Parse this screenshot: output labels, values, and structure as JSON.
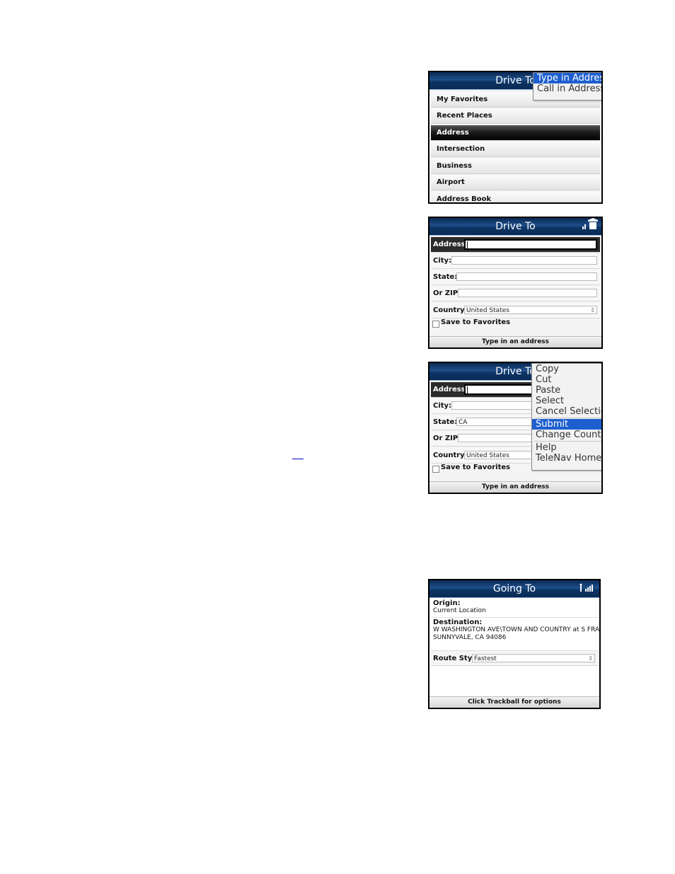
{
  "screen1": {
    "title": "Drive To",
    "menu": [
      "My Favorites",
      "Recent Places",
      "Address",
      "Intersection",
      "Business",
      "Airport",
      "Address Book"
    ],
    "selected_index": 2,
    "popup": [
      "Type in Address",
      "Call in Address"
    ],
    "popup_highlight": 0
  },
  "screen2": {
    "title": "Drive To",
    "labels": {
      "address": "Address:",
      "city": "City:",
      "state": "State:",
      "zip": "Or ZIP:",
      "country": "Country:"
    },
    "values": {
      "address": "",
      "city": "",
      "state": "",
      "zip": "",
      "country": "United States"
    },
    "save_label": "Save to Favorites",
    "status": "Type in an address"
  },
  "screen3": {
    "title": "Drive To",
    "labels": {
      "address": "Address:",
      "city": "City:",
      "state": "State:",
      "zip": "Or ZIP:",
      "country": "Country:"
    },
    "values": {
      "address": "",
      "city": "",
      "state": "CA",
      "zip": "",
      "country": "United States"
    },
    "save_label": "Save to Favorites",
    "status": "Type in an address",
    "popup": [
      "Copy",
      "Cut",
      "Paste",
      "Select",
      "Cancel Selection",
      "Submit",
      "Change Country",
      "Help",
      "TeleNav Home"
    ],
    "popup_highlight": 5
  },
  "screen4": {
    "title": "Going To",
    "origin_label": "Origin:",
    "origin_value": "Current Location",
    "destination_label": "Destination:",
    "destination_line1": "W WASHINGTON AVE\\TOWN AND COUNTRY at S FRANCE..",
    "destination_line2": "SUNNYVALE, CA 94086",
    "route_style_label": "Route Style:",
    "route_style_value": "Fastest",
    "status": "Click Trackball for options"
  },
  "icons": {
    "signal": "signal-bars-icon",
    "home": "home-icon",
    "dropdown": "dropdown-arrow-icon"
  }
}
